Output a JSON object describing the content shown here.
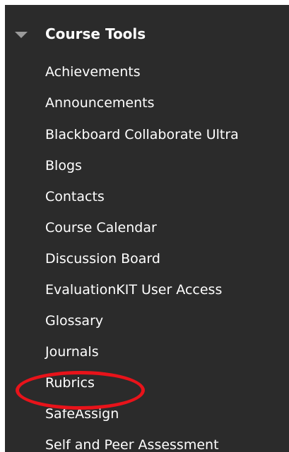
{
  "course_tools": {
    "title": "Course Tools",
    "items": [
      {
        "label": "Achievements"
      },
      {
        "label": "Announcements"
      },
      {
        "label": "Blackboard Collaborate Ultra"
      },
      {
        "label": "Blogs"
      },
      {
        "label": "Contacts"
      },
      {
        "label": "Course Calendar"
      },
      {
        "label": "Discussion Board"
      },
      {
        "label": "EvaluationKIT User Access"
      },
      {
        "label": "Glossary"
      },
      {
        "label": "Journals"
      },
      {
        "label": "Rubrics"
      },
      {
        "label": "SafeAssign"
      },
      {
        "label": "Self and Peer Assessment"
      }
    ],
    "highlighted_item": "Rubrics"
  },
  "colors": {
    "sidebar_background": "#2b2b2b",
    "text": "#ffffff",
    "chevron": "#9a9a9a",
    "highlight": "#e8131a"
  },
  "icons": {
    "section_toggle": "chevron-down-icon"
  }
}
